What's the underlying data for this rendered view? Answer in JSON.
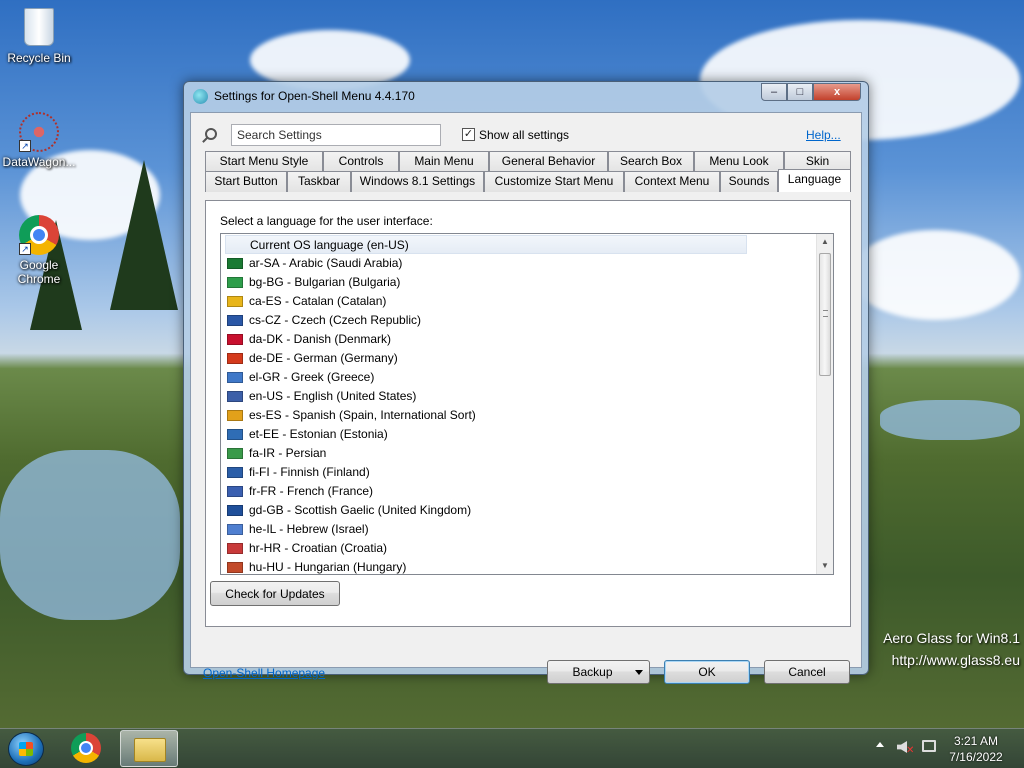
{
  "desktop": {
    "icons": [
      {
        "label": "Recycle Bin",
        "icon": "recycle-bin-icon"
      },
      {
        "label": "DataWagon...",
        "icon": "datawagon-icon"
      },
      {
        "label": "Google Chrome",
        "icon": "chrome-icon"
      }
    ],
    "watermark": {
      "line1": "Aero Glass for Win8.1",
      "line2": "http://www.glass8.eu"
    }
  },
  "window": {
    "title": "Settings for Open-Shell Menu 4.4.170",
    "controls": {
      "minimize": "–",
      "maximize": "□",
      "close": "x"
    }
  },
  "toolbar": {
    "search_value": "Search Settings",
    "show_all_checked": true,
    "show_all_label": "Show all settings",
    "help_label": "Help..."
  },
  "tabs": {
    "row1": [
      "Start Menu Style",
      "Controls",
      "Main Menu",
      "General Behavior",
      "Search Box",
      "Menu Look",
      "Skin"
    ],
    "row2": [
      "Start Button",
      "Taskbar",
      "Windows 8.1 Settings",
      "Customize Start Menu",
      "Context Menu",
      "Sounds",
      "Language"
    ],
    "active": "Language"
  },
  "language_panel": {
    "label": "Select a language for the user interface:",
    "items": [
      {
        "label": "Current OS language (en-US)",
        "flag": "",
        "selected": true
      },
      {
        "label": "ar-SA - Arabic (Saudi Arabia)",
        "flag": "#1a7a33"
      },
      {
        "label": "bg-BG - Bulgarian (Bulgaria)",
        "flag": "#2e9e4b"
      },
      {
        "label": "ca-ES - Catalan (Catalan)",
        "flag": "#e8b51a"
      },
      {
        "label": "cs-CZ - Czech (Czech Republic)",
        "flag": "#2a57a6"
      },
      {
        "label": "da-DK - Danish (Denmark)",
        "flag": "#c8102e"
      },
      {
        "label": "de-DE - German (Germany)",
        "flag": "#d43a1c"
      },
      {
        "label": "el-GR - Greek (Greece)",
        "flag": "#3f78c8"
      },
      {
        "label": "en-US - English (United States)",
        "flag": "#3c5fa8"
      },
      {
        "label": "es-ES - Spanish (Spain, International Sort)",
        "flag": "#e2a11a"
      },
      {
        "label": "et-EE - Estonian (Estonia)",
        "flag": "#2f6db5"
      },
      {
        "label": "fa-IR - Persian",
        "flag": "#3a9a4a"
      },
      {
        "label": "fi-FI - Finnish (Finland)",
        "flag": "#2b5ea8"
      },
      {
        "label": "fr-FR - French (France)",
        "flag": "#3a5fb0"
      },
      {
        "label": "gd-GB - Scottish Gaelic (United Kingdom)",
        "flag": "#1f4f9a"
      },
      {
        "label": "he-IL - Hebrew (Israel)",
        "flag": "#4f7fd0"
      },
      {
        "label": "hr-HR - Croatian (Croatia)",
        "flag": "#c83a3a"
      },
      {
        "label": "hu-HU - Hungarian (Hungary)",
        "flag": "#c24a2a"
      }
    ],
    "check_updates_label": "Check for Updates"
  },
  "footer": {
    "homepage_label": "Open-Shell Homepage",
    "backup_label": "Backup",
    "ok_label": "OK",
    "cancel_label": "Cancel"
  },
  "taskbar": {
    "time": "3:21 AM",
    "date": "7/16/2022"
  }
}
